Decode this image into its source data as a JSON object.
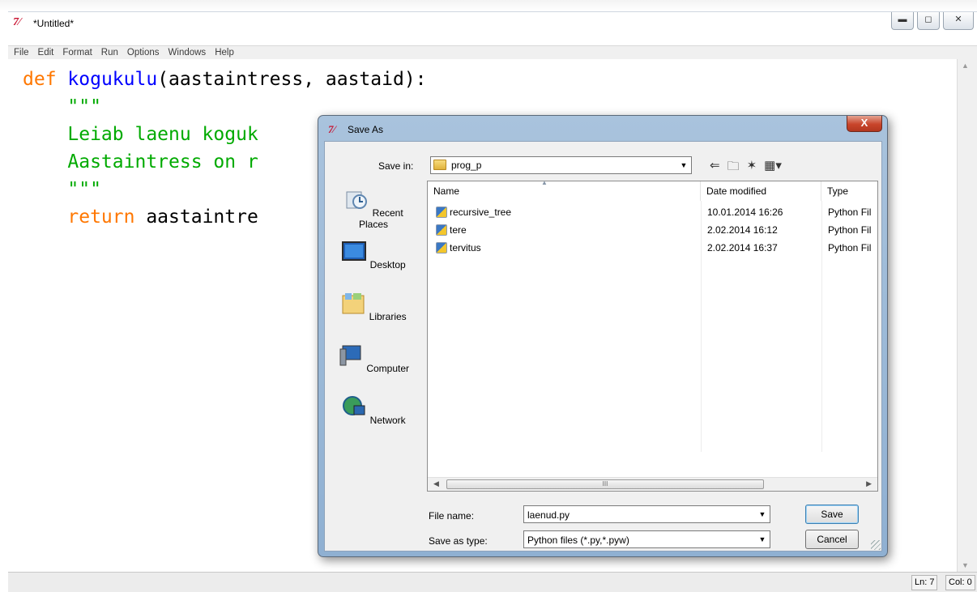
{
  "window": {
    "title": "*Untitled*",
    "icon": "tk-feather-icon"
  },
  "menu": [
    "File",
    "Edit",
    "Format",
    "Run",
    "Options",
    "Windows",
    "Help"
  ],
  "code": {
    "l1_kw": "def",
    "l1_name": "kogukulu",
    "l1_rest": "(aastaintress, aastaid):",
    "l2": "\"\"\"",
    "l3": "Leiab laenu koguk",
    "l4": "Aastaintress on r",
    "l5": "\"\"\"",
    "l6_kw": "return",
    "l6_rest": " aastaintre"
  },
  "status": {
    "ln": "Ln: 7",
    "col": "Col: 0"
  },
  "dialog": {
    "title": "Save As",
    "save_in_label": "Save in:",
    "save_in_value": "prog_p",
    "places": [
      "Recent Places",
      "Desktop",
      "Libraries",
      "Computer",
      "Network"
    ],
    "columns": [
      "Name",
      "Date modified",
      "Type"
    ],
    "files": [
      {
        "name": "recursive_tree",
        "date": "10.01.2014 16:26",
        "type": "Python Fil"
      },
      {
        "name": "tere",
        "date": "2.02.2014 16:12",
        "type": "Python Fil"
      },
      {
        "name": "tervitus",
        "date": "2.02.2014 16:37",
        "type": "Python Fil"
      }
    ],
    "file_name_label": "File name:",
    "file_name_value": "laenud.py",
    "save_type_label": "Save as type:",
    "save_type_value": "Python files (*.py,*.pyw)",
    "save_button": "Save",
    "cancel_button": "Cancel",
    "close_glyph": "X",
    "scroll_grip": "III"
  }
}
